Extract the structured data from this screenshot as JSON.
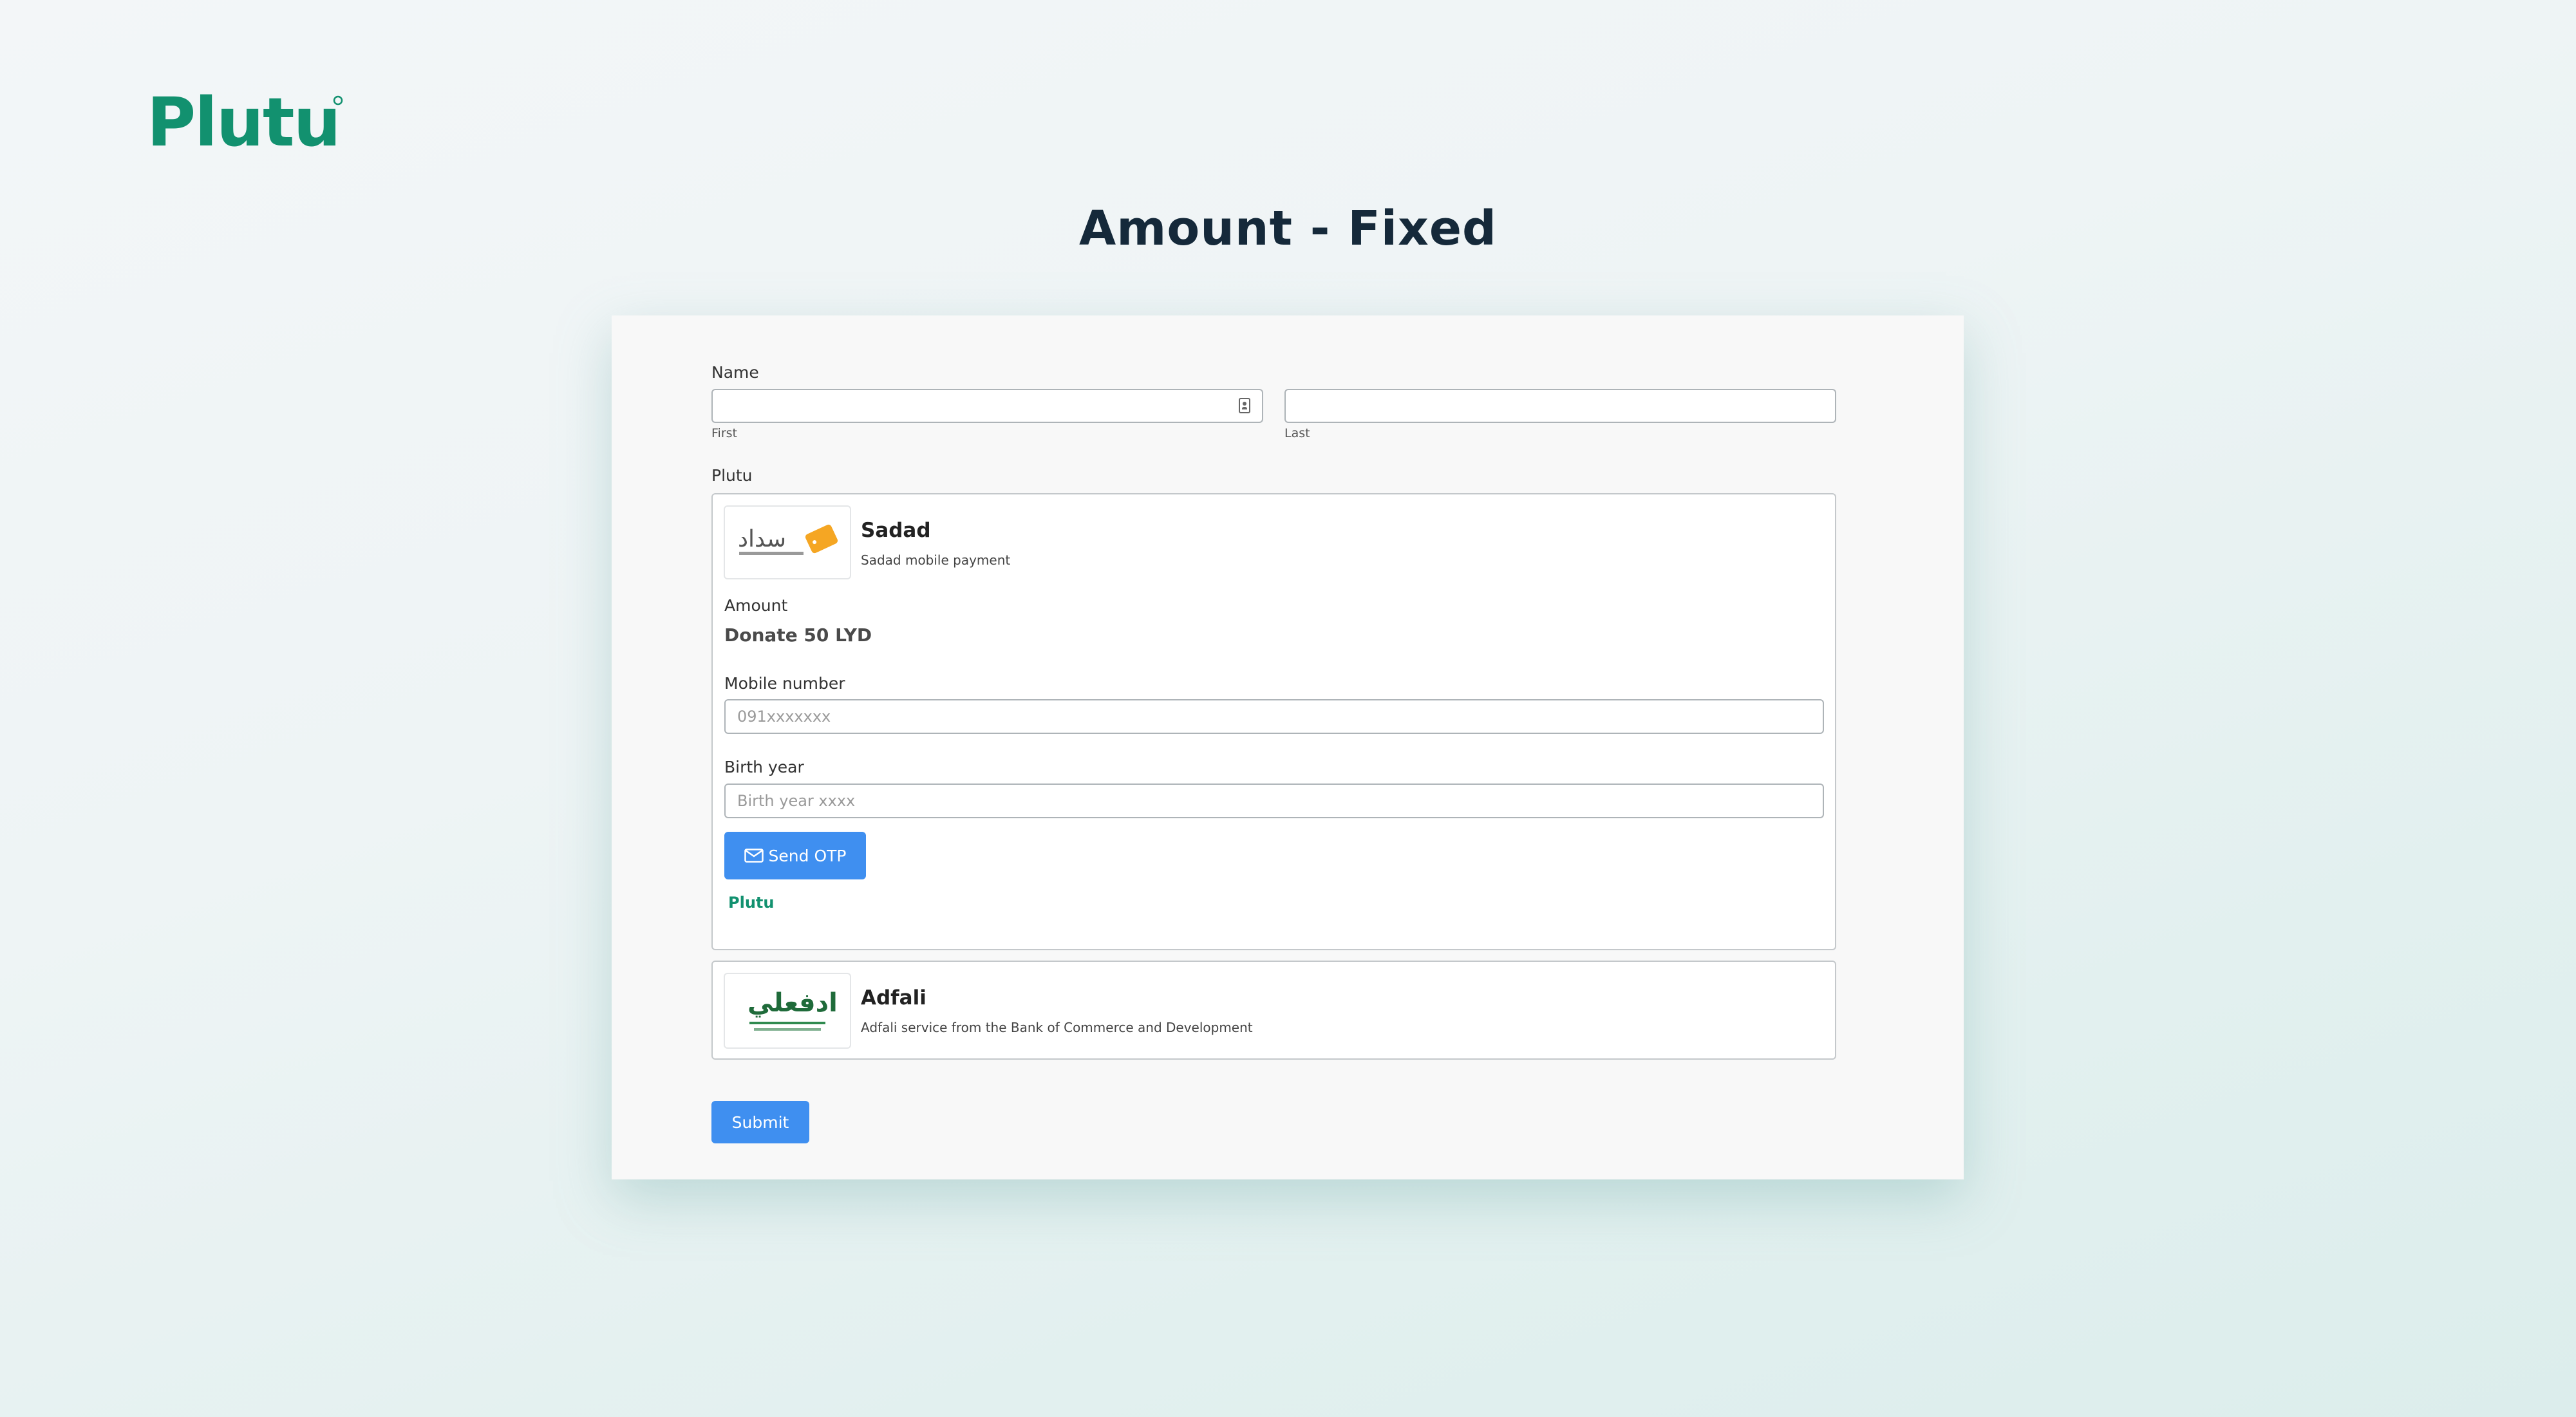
{
  "brand": {
    "name": "Plutu",
    "color": "#12916f"
  },
  "page": {
    "title": "Amount - Fixed"
  },
  "form": {
    "name_label": "Name",
    "first_sublabel": "First",
    "last_sublabel": "Last",
    "first_value": "",
    "last_value": "",
    "gateway_label": "Plutu",
    "methods": [
      {
        "title": "Sadad",
        "description": "Sadad mobile payment",
        "logo_text": "سداد",
        "amount_label": "Amount",
        "amount_value": "Donate 50 LYD",
        "mobile_label": "Mobile number",
        "mobile_placeholder": "091xxxxxxx",
        "birth_label": "Birth year",
        "birth_placeholder": "Birth year xxxx",
        "otp_button": "Send OTP",
        "powered_by": "Plutu"
      },
      {
        "title": "Adfali",
        "description": "Adfali service from the Bank of Commerce and Development",
        "logo_text": "ادفعلي"
      }
    ],
    "submit_button": "Submit",
    "accent_color": "#3f8ff0"
  }
}
